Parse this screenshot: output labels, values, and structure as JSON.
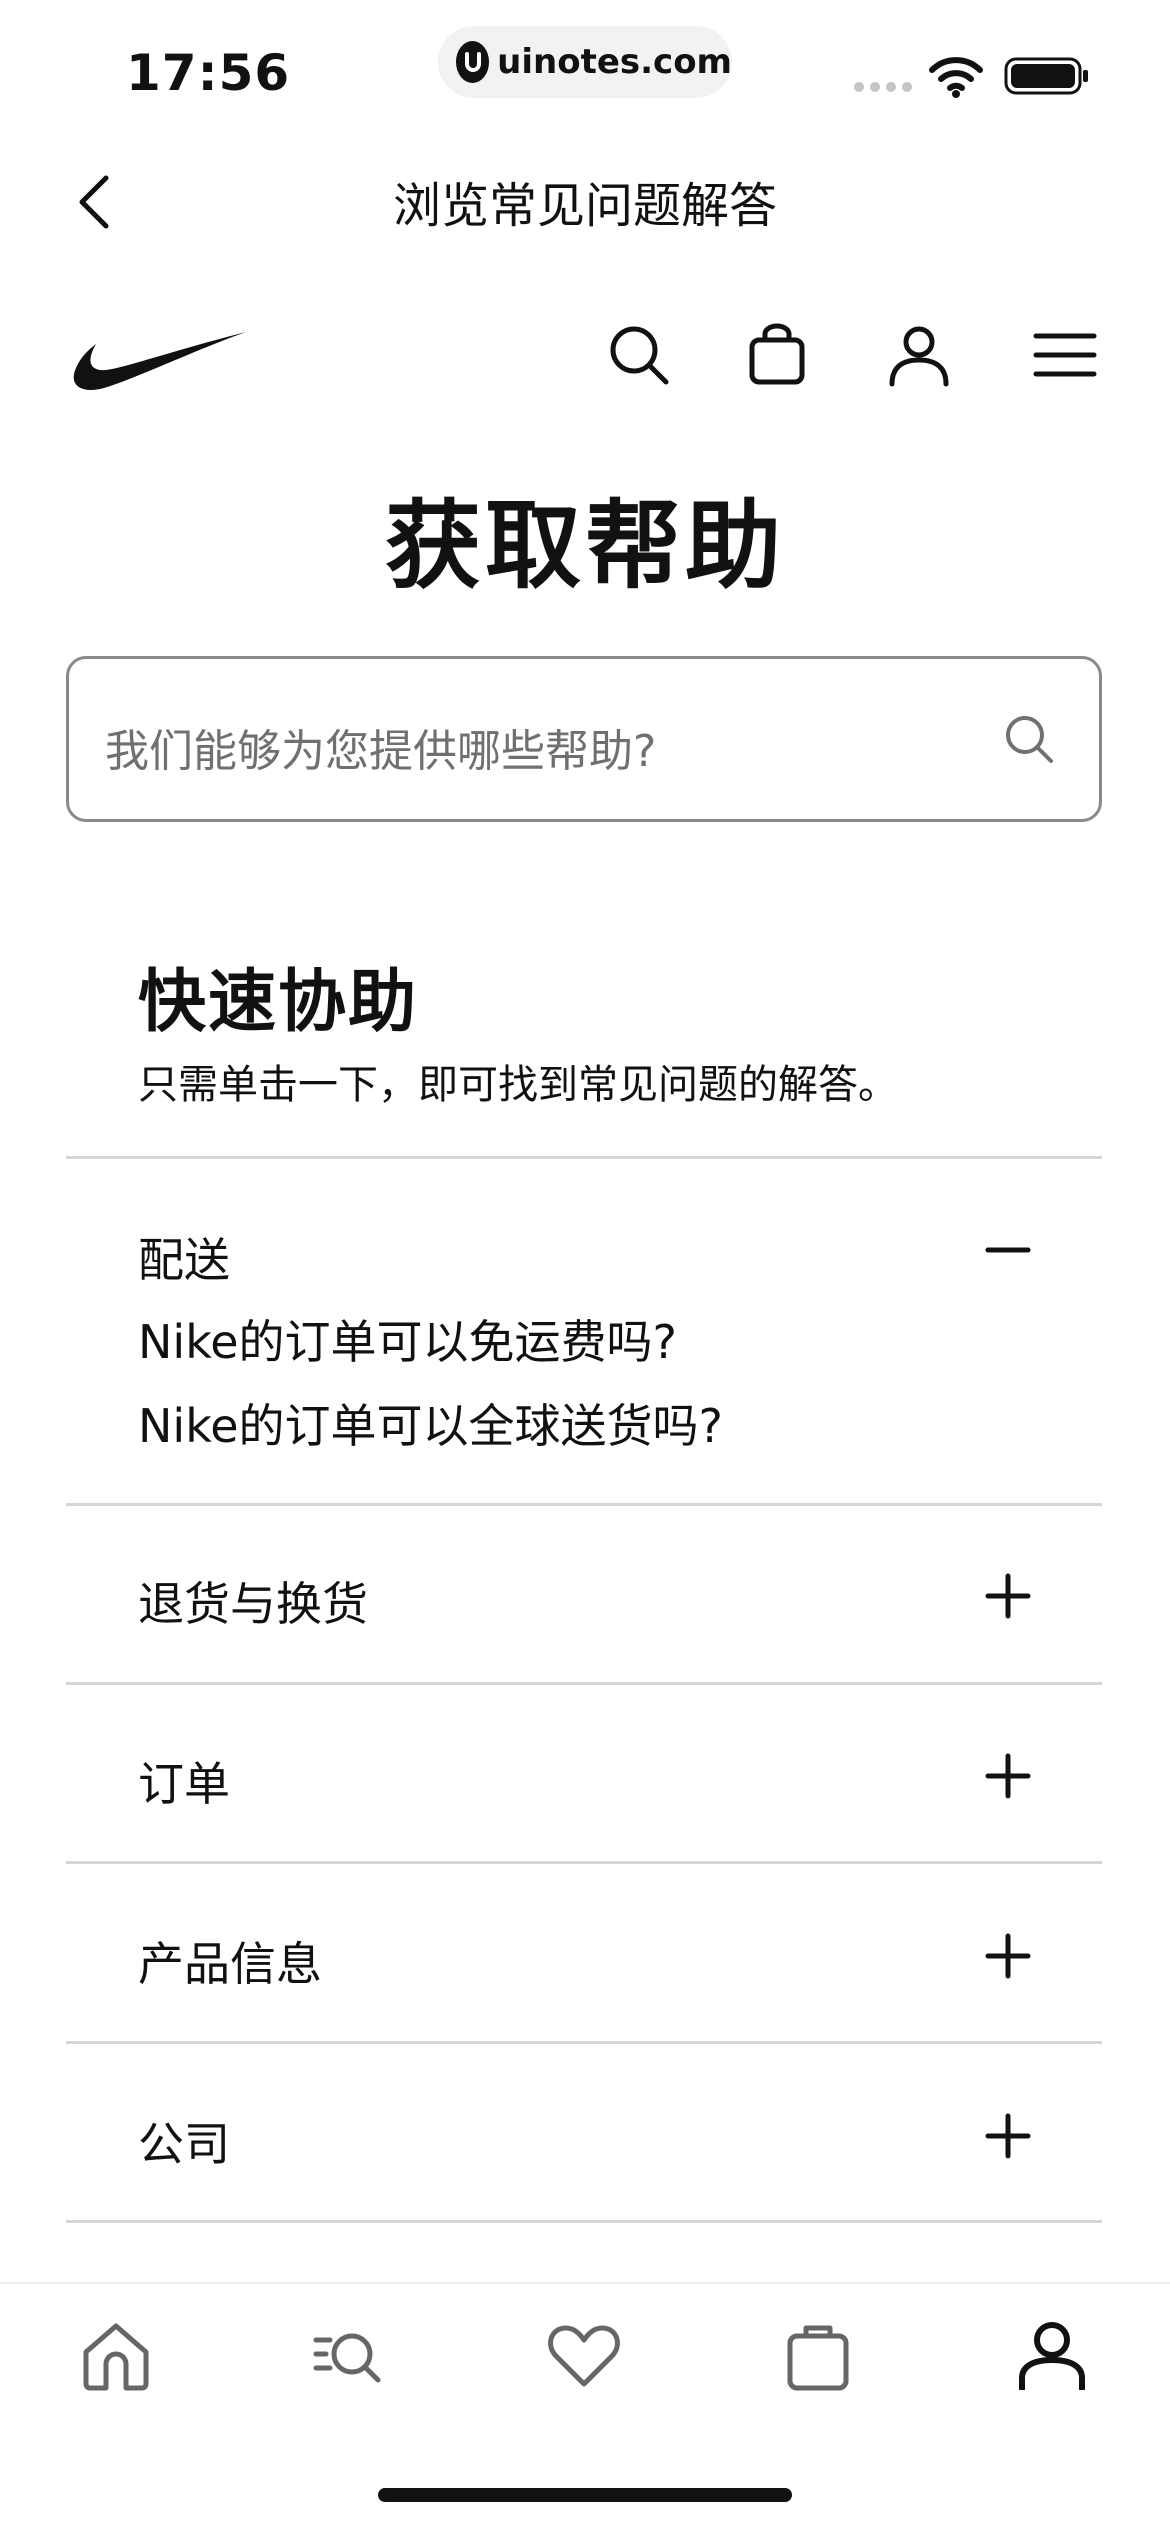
{
  "status_bar": {
    "time": "17:56",
    "url": "uinotes.com"
  },
  "nav": {
    "title": "浏览常见问题解答"
  },
  "header": {
    "icons": [
      "swoosh-logo",
      "search-icon",
      "bag-icon",
      "profile-icon",
      "menu-icon"
    ]
  },
  "page": {
    "title": "获取帮助"
  },
  "search": {
    "placeholder": "我们能够为您提供哪些帮助?"
  },
  "quick_help": {
    "title": "快速协助",
    "subtitle": "只需单击一下，即可找到常见问题的解答。",
    "sections": [
      {
        "label": "配送",
        "expanded": true,
        "links": [
          "Nike的订单可以免运费吗?",
          "Nike的订单可以全球送货吗?"
        ]
      },
      {
        "label": "退货与换货",
        "expanded": false
      },
      {
        "label": "订单",
        "expanded": false
      },
      {
        "label": "产品信息",
        "expanded": false
      },
      {
        "label": "公司",
        "expanded": false
      }
    ]
  },
  "tabbar": {
    "items": [
      "home-icon",
      "shop-search-icon",
      "favorites-heart-icon",
      "bag-icon",
      "profile-icon"
    ]
  },
  "colors": {
    "text": "#111111",
    "muted": "#707070",
    "divider": "#d6d6d6"
  }
}
